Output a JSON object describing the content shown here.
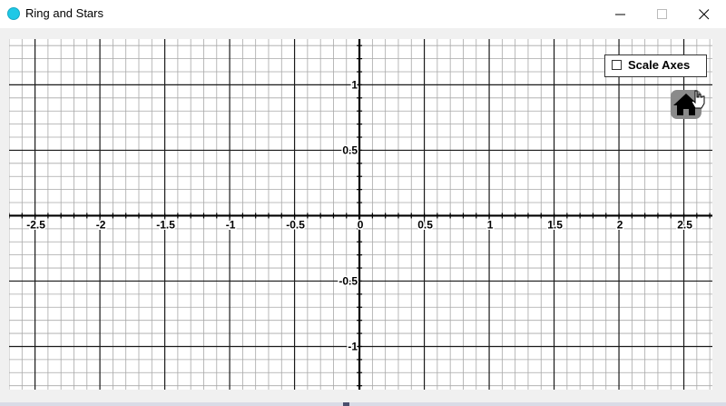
{
  "window": {
    "title": "Ring and Stars"
  },
  "controls": {
    "scale_axes_label": "Scale Axes",
    "scale_axes_checked": false
  },
  "icons": {
    "app": "ring-app-icon",
    "minimize": "minimize-icon",
    "maximize": "maximize-icon",
    "close": "close-icon",
    "home": "home-icon",
    "cursor": "hand-pointer-icon"
  },
  "plot": {
    "x_range": [
      -2.7,
      2.72
    ],
    "y_range": [
      -1.33,
      1.35
    ],
    "x_ticks": [
      "-2.5",
      "-2",
      "-1.5",
      "-1",
      "-0.5",
      "0",
      "0.5",
      "1",
      "1.5",
      "2",
      "2.5"
    ],
    "y_ticks": [
      "1",
      "0.5",
      "-0.5",
      "-1"
    ],
    "grid": true,
    "major_grid_step": 0.5,
    "minor_grid_step": 0.1
  }
}
